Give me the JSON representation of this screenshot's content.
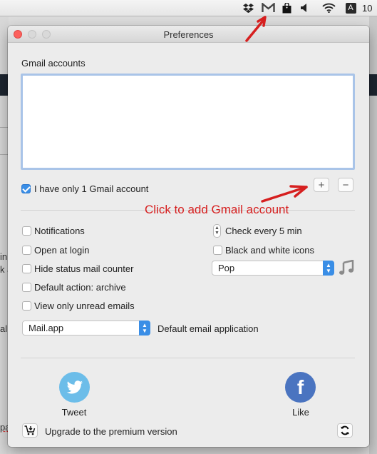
{
  "menubar": {
    "icons": [
      "dropbox-icon",
      "gmail-notifier-icon",
      "shopping-bag-icon",
      "volume-icon",
      "wifi-icon",
      "input-source-icon"
    ],
    "input_source_label": "A",
    "battery_text": "10"
  },
  "background": {
    "fragments": [
      "in",
      "k a",
      "al",
      "pa"
    ]
  },
  "window": {
    "title": "Preferences",
    "accounts_label": "Gmail accounts",
    "single_account": {
      "label": "I have only 1 Gmail account",
      "checked": true
    },
    "add_button": "+",
    "remove_button": "−",
    "annotation": "Click to add Gmail account",
    "annotation_color": "#d61f1f",
    "options_left": [
      {
        "label": "Notifications",
        "checked": false
      },
      {
        "label": "Open at login",
        "checked": false
      },
      {
        "label": "Hide status mail counter",
        "checked": false
      },
      {
        "label": "Default action: archive",
        "checked": false
      },
      {
        "label": "View only unread emails",
        "checked": false
      }
    ],
    "check_interval": {
      "label": "Check every 5 min",
      "value": 5,
      "unit": "min"
    },
    "bw_icons": {
      "label": "Black and white icons",
      "checked": false
    },
    "sound": {
      "selected": "Pop"
    },
    "email_app": {
      "selected": "Mail.app",
      "label": "Default email application"
    },
    "tweet_label": "Tweet",
    "like_label": "Like",
    "upgrade_label": "Upgrade to the premium version",
    "colors": {
      "accent": "#3a8ee6",
      "twitter": "#6cbde9",
      "facebook": "#4a74c0",
      "close": "#fc605c"
    }
  }
}
